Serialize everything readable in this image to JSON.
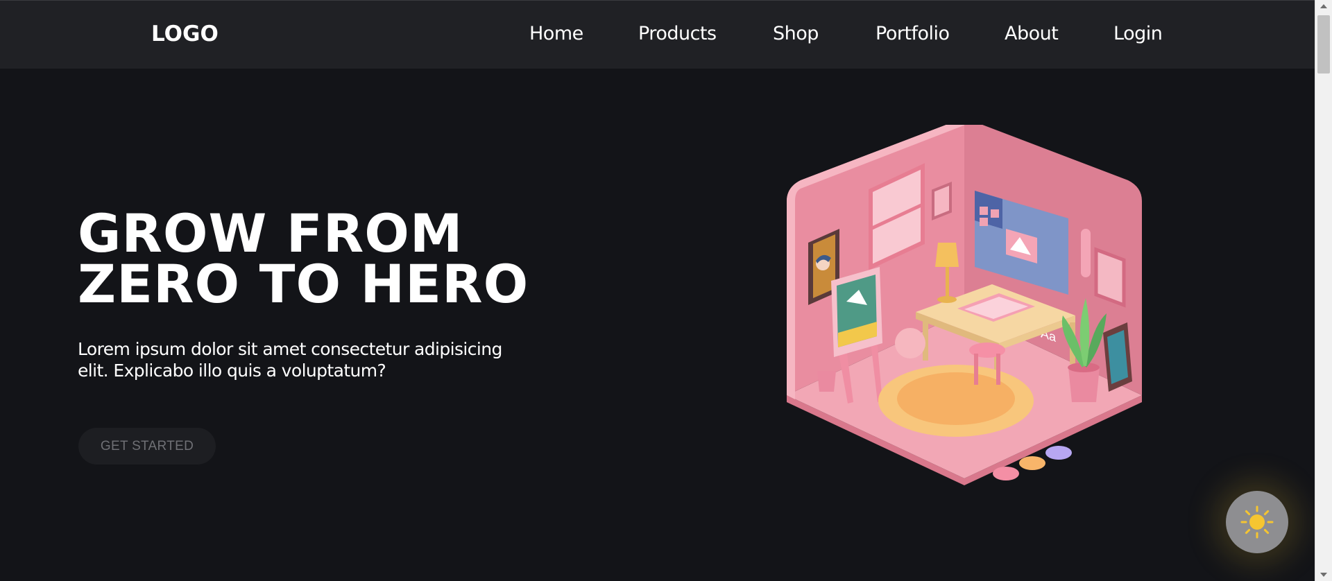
{
  "header": {
    "logo": "LOGO",
    "nav": [
      {
        "label": "Home"
      },
      {
        "label": "Products"
      },
      {
        "label": "Shop"
      },
      {
        "label": "Portfolio"
      },
      {
        "label": "About"
      },
      {
        "label": "Login"
      }
    ]
  },
  "hero": {
    "title_line1": "GROW FROM",
    "title_line2": "ZERO TO HERO",
    "text": "Lorem ipsum dolor sit amet consectetur adipisicing elit. Explicabo illo quis a voluptatum?",
    "cta_label": "GET STARTED",
    "illustration_icon": "isometric-room-illustration"
  },
  "theme_toggle": {
    "icon": "sun-icon"
  },
  "colors": {
    "background": "#131418",
    "navbar": "#202125",
    "button_bg": "#1d1e22",
    "accent_sun": "#f5c531",
    "room_pink": "#e98da0"
  }
}
